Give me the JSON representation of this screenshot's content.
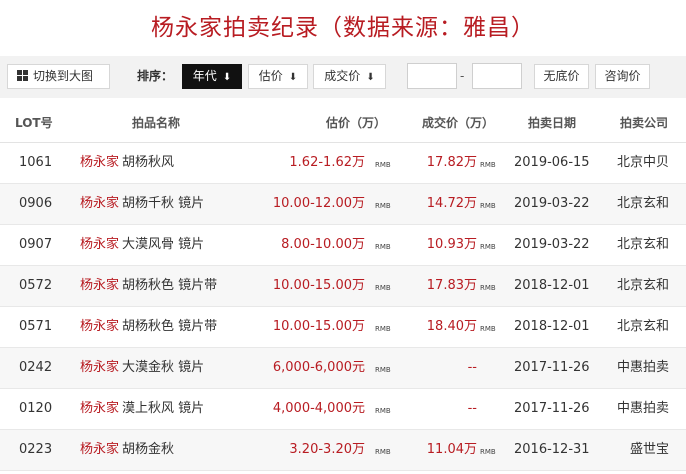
{
  "title": "杨永家拍卖纪录（数据来源：雅昌）",
  "toolbar": {
    "switch_label": "切换到大图",
    "sort_label": "排序：",
    "sort_year": "年代",
    "sort_estimate": "估价",
    "sort_deal": "成交价",
    "arrow": "⬇",
    "dash": "-",
    "no_reserve": "无底价",
    "inquiry": "咨询价"
  },
  "columns": {
    "lot": "LOT号",
    "name": "拍品名称",
    "estimate": "估价（万）",
    "deal": "成交价（万）",
    "date": "拍卖日期",
    "company": "拍卖公司"
  },
  "unit": "RMB",
  "rows": [
    {
      "lot": "1061",
      "artist": "杨永家",
      "name": "胡杨秋风",
      "estimate": "1.62-1.62万",
      "deal": "17.82万",
      "date": "2019-06-15",
      "company": "北京中贝"
    },
    {
      "lot": "0906",
      "artist": "杨永家",
      "name": "胡杨千秋  镜片",
      "estimate": "10.00-12.00万",
      "deal": "14.72万",
      "date": "2019-03-22",
      "company": "北京玄和"
    },
    {
      "lot": "0907",
      "artist": "杨永家",
      "name": "大漠风骨  镜片",
      "estimate": "8.00-10.00万",
      "deal": "10.93万",
      "date": "2019-03-22",
      "company": "北京玄和"
    },
    {
      "lot": "0572",
      "artist": "杨永家",
      "name": "胡杨秋色  镜片带",
      "estimate": "10.00-15.00万",
      "deal": "17.83万",
      "date": "2018-12-01",
      "company": "北京玄和"
    },
    {
      "lot": "0571",
      "artist": "杨永家",
      "name": "胡杨秋色  镜片带",
      "estimate": "10.00-15.00万",
      "deal": "18.40万",
      "date": "2018-12-01",
      "company": "北京玄和"
    },
    {
      "lot": "0242",
      "artist": "杨永家",
      "name": "大漠金秋  镜片",
      "estimate": "6,000-6,000元",
      "deal": "--",
      "date": "2017-11-26",
      "company": "中惠拍卖"
    },
    {
      "lot": "0120",
      "artist": "杨永家",
      "name": "漠上秋风  镜片",
      "estimate": "4,000-4,000元",
      "deal": "--",
      "date": "2017-11-26",
      "company": "中惠拍卖"
    },
    {
      "lot": "0223",
      "artist": "杨永家",
      "name": "胡杨金秋",
      "estimate": "3.20-3.20万",
      "deal": "11.04万",
      "date": "2016-12-31",
      "company": "盛世宝"
    }
  ]
}
